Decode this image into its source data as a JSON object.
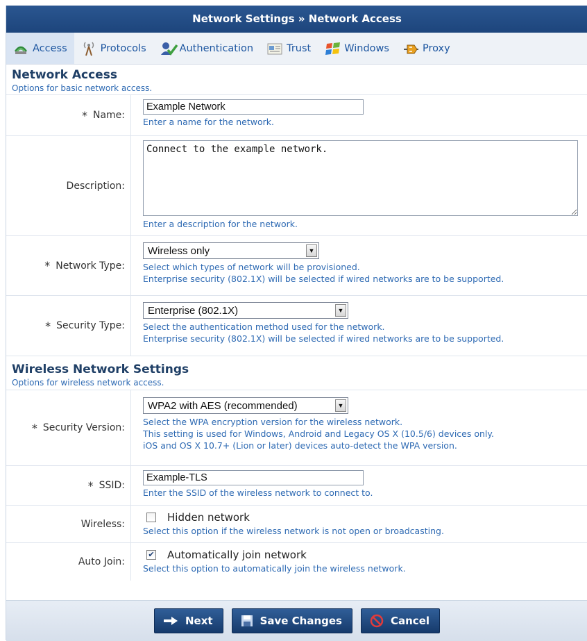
{
  "title": "Network Settings » Network Access",
  "tabs": [
    {
      "label": "Access",
      "icon": "access-icon"
    },
    {
      "label": "Protocols",
      "icon": "protocols-icon"
    },
    {
      "label": "Authentication",
      "icon": "authentication-icon"
    },
    {
      "label": "Trust",
      "icon": "trust-icon"
    },
    {
      "label": "Windows",
      "icon": "windows-icon"
    },
    {
      "label": "Proxy",
      "icon": "proxy-icon"
    }
  ],
  "network_access": {
    "heading": "Network Access",
    "sub": "Options for basic network access."
  },
  "fields": {
    "name": {
      "req": "*",
      "label": "Name:",
      "value": "Example Network",
      "hint": "Enter a name for the network."
    },
    "description": {
      "label": "Description:",
      "value": "Connect to the example network.",
      "hint": "Enter a description for the network."
    },
    "network_type": {
      "req": "*",
      "label": "Network Type:",
      "value": "Wireless only",
      "hint1": "Select which types of network will be provisioned.",
      "hint2": "Enterprise security (802.1X) will be selected if wired networks are to be supported."
    },
    "security_type": {
      "req": "*",
      "label": "Security Type:",
      "value": "Enterprise (802.1X)",
      "hint1": "Select the authentication method used for the network.",
      "hint2": "Enterprise security (802.1X) will be selected if wired networks are to be supported."
    }
  },
  "wireless": {
    "heading": "Wireless Network Settings",
    "sub": "Options for wireless network access.",
    "security_version": {
      "req": "*",
      "label": "Security Version:",
      "value": "WPA2 with AES (recommended)",
      "hint1": "Select the WPA encryption version for the wireless network.",
      "hint2": "This setting is used for Windows, Android and Legacy OS X (10.5/6) devices only.",
      "hint3": "iOS and OS X 10.7+ (Lion or later) devices auto-detect the WPA version."
    },
    "ssid": {
      "req": "*",
      "label": "SSID:",
      "value": "Example-TLS",
      "hint": "Enter the SSID of the wireless network to connect to."
    },
    "hidden": {
      "label": "Wireless:",
      "option": "Hidden network",
      "checked": false,
      "hint": "Select this option if the wireless network is not open or broadcasting."
    },
    "auto_join": {
      "label": "Auto Join:",
      "option": "Automatically join network",
      "checked": true,
      "hint": "Select this option to automatically join the wireless network."
    }
  },
  "buttons": {
    "next": "Next",
    "save": "Save Changes",
    "cancel": "Cancel"
  },
  "colors": {
    "header": "#1d457c",
    "link": "#2e6ab3",
    "button": "#1f4579"
  }
}
